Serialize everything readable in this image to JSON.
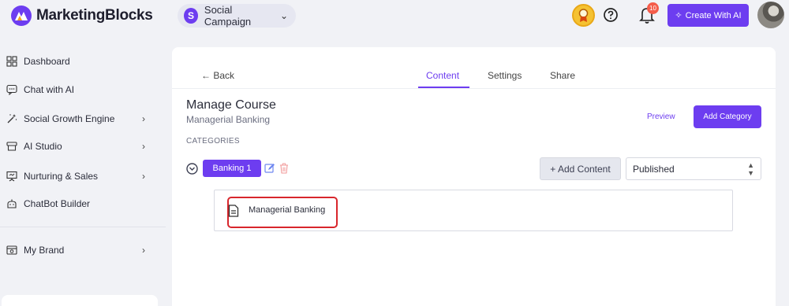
{
  "app": {
    "logo_text": "MarketingBlocks"
  },
  "header": {
    "workspace_initial": "S",
    "workspace_name": "Social Campaign",
    "notification_count": "10",
    "create_button_label": "Create With AI"
  },
  "sidebar": {
    "items": [
      {
        "label": "Dashboard",
        "icon": "grid-icon",
        "has_chevron": false
      },
      {
        "label": "Chat with AI",
        "icon": "chat-icon",
        "has_chevron": false
      },
      {
        "label": "Social Growth Engine",
        "icon": "magic-wand-icon",
        "has_chevron": true
      },
      {
        "label": "AI Studio",
        "icon": "studio-icon",
        "has_chevron": true
      },
      {
        "label": "Nurturing & Sales",
        "icon": "presentation-icon",
        "has_chevron": true
      },
      {
        "label": "ChatBot Builder",
        "icon": "bot-icon",
        "has_chevron": false
      },
      {
        "label": "My Brand",
        "icon": "brand-icon",
        "has_chevron": true
      }
    ]
  },
  "main": {
    "back_label": "← Back",
    "tabs": [
      {
        "label": "Content",
        "active": true
      },
      {
        "label": "Settings",
        "active": false
      },
      {
        "label": "Share",
        "active": false
      }
    ],
    "title": "Manage Course",
    "subtitle": "Managerial Banking",
    "section_label": "CATEGORIES",
    "preview_label": "Preview",
    "add_category_label": "Add Category",
    "category": {
      "name": "Banking 1",
      "add_content_label": "+ Add Content",
      "status": "Published",
      "items": [
        {
          "label": "Managerial Banking",
          "icon": "document-icon"
        }
      ]
    }
  },
  "colors": {
    "accent": "#6d3df0",
    "highlight_border": "#d8262c",
    "background": "#f1f2f6"
  }
}
